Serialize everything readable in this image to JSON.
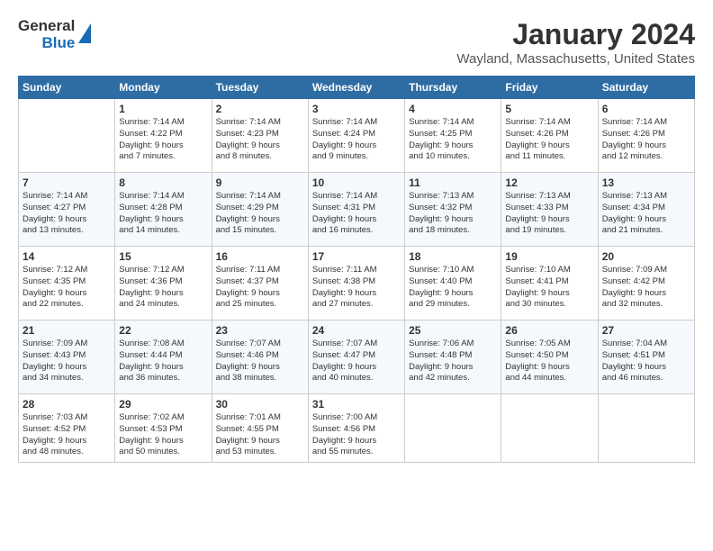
{
  "header": {
    "logo_general": "General",
    "logo_blue": "Blue",
    "month_title": "January 2024",
    "location": "Wayland, Massachusetts, United States"
  },
  "days_of_week": [
    "Sunday",
    "Monday",
    "Tuesday",
    "Wednesday",
    "Thursday",
    "Friday",
    "Saturday"
  ],
  "weeks": [
    [
      {
        "day": "",
        "content": ""
      },
      {
        "day": "1",
        "content": "Sunrise: 7:14 AM\nSunset: 4:22 PM\nDaylight: 9 hours\nand 7 minutes."
      },
      {
        "day": "2",
        "content": "Sunrise: 7:14 AM\nSunset: 4:23 PM\nDaylight: 9 hours\nand 8 minutes."
      },
      {
        "day": "3",
        "content": "Sunrise: 7:14 AM\nSunset: 4:24 PM\nDaylight: 9 hours\nand 9 minutes."
      },
      {
        "day": "4",
        "content": "Sunrise: 7:14 AM\nSunset: 4:25 PM\nDaylight: 9 hours\nand 10 minutes."
      },
      {
        "day": "5",
        "content": "Sunrise: 7:14 AM\nSunset: 4:26 PM\nDaylight: 9 hours\nand 11 minutes."
      },
      {
        "day": "6",
        "content": "Sunrise: 7:14 AM\nSunset: 4:26 PM\nDaylight: 9 hours\nand 12 minutes."
      }
    ],
    [
      {
        "day": "7",
        "content": "Sunrise: 7:14 AM\nSunset: 4:27 PM\nDaylight: 9 hours\nand 13 minutes."
      },
      {
        "day": "8",
        "content": "Sunrise: 7:14 AM\nSunset: 4:28 PM\nDaylight: 9 hours\nand 14 minutes."
      },
      {
        "day": "9",
        "content": "Sunrise: 7:14 AM\nSunset: 4:29 PM\nDaylight: 9 hours\nand 15 minutes."
      },
      {
        "day": "10",
        "content": "Sunrise: 7:14 AM\nSunset: 4:31 PM\nDaylight: 9 hours\nand 16 minutes."
      },
      {
        "day": "11",
        "content": "Sunrise: 7:13 AM\nSunset: 4:32 PM\nDaylight: 9 hours\nand 18 minutes."
      },
      {
        "day": "12",
        "content": "Sunrise: 7:13 AM\nSunset: 4:33 PM\nDaylight: 9 hours\nand 19 minutes."
      },
      {
        "day": "13",
        "content": "Sunrise: 7:13 AM\nSunset: 4:34 PM\nDaylight: 9 hours\nand 21 minutes."
      }
    ],
    [
      {
        "day": "14",
        "content": "Sunrise: 7:12 AM\nSunset: 4:35 PM\nDaylight: 9 hours\nand 22 minutes."
      },
      {
        "day": "15",
        "content": "Sunrise: 7:12 AM\nSunset: 4:36 PM\nDaylight: 9 hours\nand 24 minutes."
      },
      {
        "day": "16",
        "content": "Sunrise: 7:11 AM\nSunset: 4:37 PM\nDaylight: 9 hours\nand 25 minutes."
      },
      {
        "day": "17",
        "content": "Sunrise: 7:11 AM\nSunset: 4:38 PM\nDaylight: 9 hours\nand 27 minutes."
      },
      {
        "day": "18",
        "content": "Sunrise: 7:10 AM\nSunset: 4:40 PM\nDaylight: 9 hours\nand 29 minutes."
      },
      {
        "day": "19",
        "content": "Sunrise: 7:10 AM\nSunset: 4:41 PM\nDaylight: 9 hours\nand 30 minutes."
      },
      {
        "day": "20",
        "content": "Sunrise: 7:09 AM\nSunset: 4:42 PM\nDaylight: 9 hours\nand 32 minutes."
      }
    ],
    [
      {
        "day": "21",
        "content": "Sunrise: 7:09 AM\nSunset: 4:43 PM\nDaylight: 9 hours\nand 34 minutes."
      },
      {
        "day": "22",
        "content": "Sunrise: 7:08 AM\nSunset: 4:44 PM\nDaylight: 9 hours\nand 36 minutes."
      },
      {
        "day": "23",
        "content": "Sunrise: 7:07 AM\nSunset: 4:46 PM\nDaylight: 9 hours\nand 38 minutes."
      },
      {
        "day": "24",
        "content": "Sunrise: 7:07 AM\nSunset: 4:47 PM\nDaylight: 9 hours\nand 40 minutes."
      },
      {
        "day": "25",
        "content": "Sunrise: 7:06 AM\nSunset: 4:48 PM\nDaylight: 9 hours\nand 42 minutes."
      },
      {
        "day": "26",
        "content": "Sunrise: 7:05 AM\nSunset: 4:50 PM\nDaylight: 9 hours\nand 44 minutes."
      },
      {
        "day": "27",
        "content": "Sunrise: 7:04 AM\nSunset: 4:51 PM\nDaylight: 9 hours\nand 46 minutes."
      }
    ],
    [
      {
        "day": "28",
        "content": "Sunrise: 7:03 AM\nSunset: 4:52 PM\nDaylight: 9 hours\nand 48 minutes."
      },
      {
        "day": "29",
        "content": "Sunrise: 7:02 AM\nSunset: 4:53 PM\nDaylight: 9 hours\nand 50 minutes."
      },
      {
        "day": "30",
        "content": "Sunrise: 7:01 AM\nSunset: 4:55 PM\nDaylight: 9 hours\nand 53 minutes."
      },
      {
        "day": "31",
        "content": "Sunrise: 7:00 AM\nSunset: 4:56 PM\nDaylight: 9 hours\nand 55 minutes."
      },
      {
        "day": "",
        "content": ""
      },
      {
        "day": "",
        "content": ""
      },
      {
        "day": "",
        "content": ""
      }
    ]
  ]
}
